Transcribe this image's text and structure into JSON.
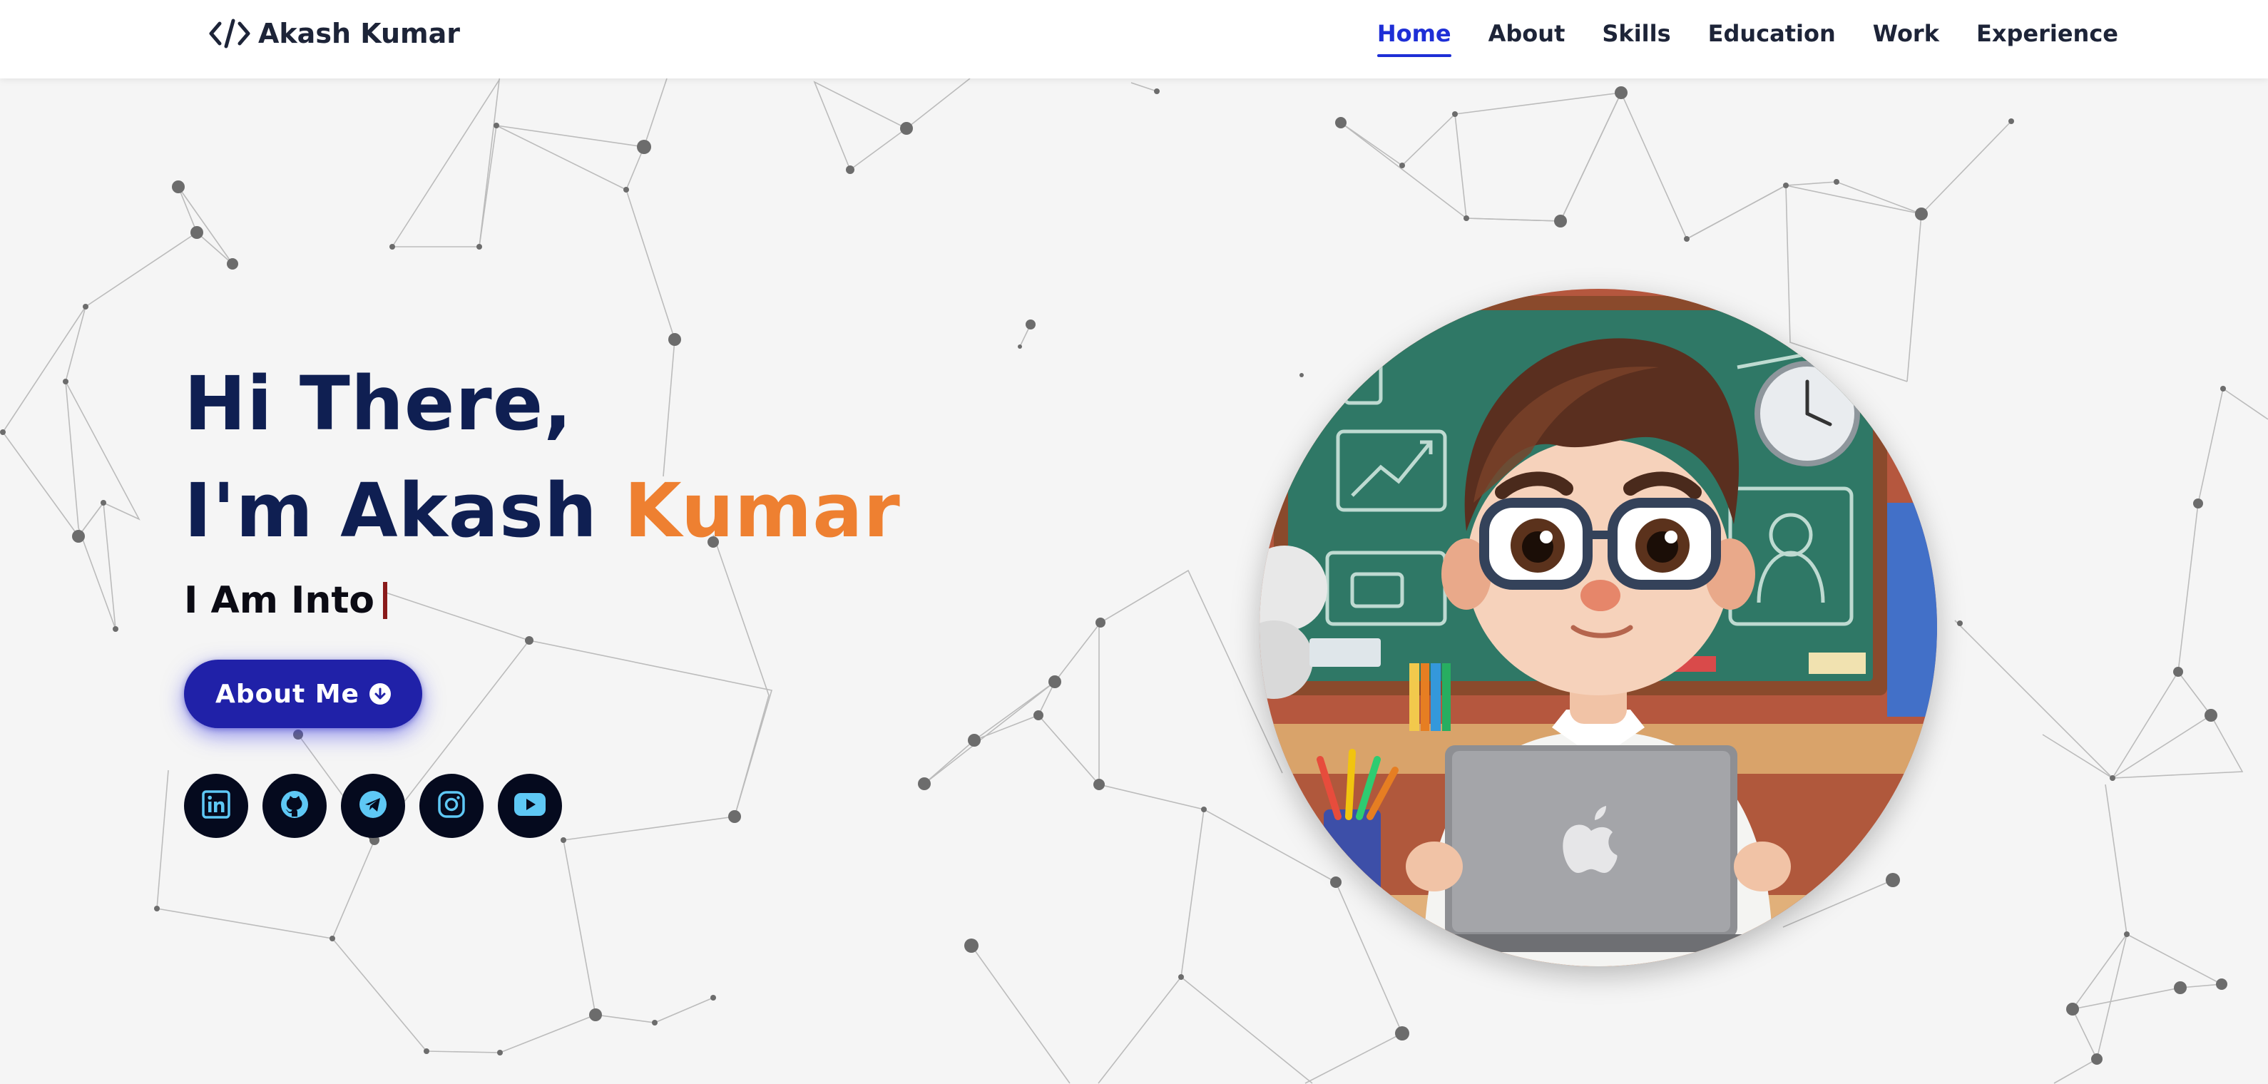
{
  "brand": {
    "name": "Akash Kumar",
    "icon": "code-icon"
  },
  "nav": {
    "items": [
      {
        "label": "Home",
        "active": true
      },
      {
        "label": "About",
        "active": false
      },
      {
        "label": "Skills",
        "active": false
      },
      {
        "label": "Education",
        "active": false
      },
      {
        "label": "Work",
        "active": false
      },
      {
        "label": "Experience",
        "active": false
      }
    ],
    "active_color": "#1e2fd6"
  },
  "hero": {
    "greeting": "Hi There,",
    "intro_prefix": "I'm Akash ",
    "intro_accent": "Kumar",
    "typing_prefix": "I Am Into",
    "accent_color": "#ee8031",
    "button_label": "About Me",
    "button_icon": "arrow-down-circle-icon"
  },
  "socials": [
    {
      "name": "linkedin",
      "icon": "linkedin-icon"
    },
    {
      "name": "github",
      "icon": "github-icon"
    },
    {
      "name": "telegram",
      "icon": "telegram-icon"
    },
    {
      "name": "instagram",
      "icon": "instagram-icon"
    },
    {
      "name": "youtube",
      "icon": "youtube-icon"
    }
  ],
  "colors": {
    "background": "#f5f5f5",
    "heading": "#0f1f52",
    "button": "#2021a8",
    "social_bg": "#050a1e",
    "social_icon": "#5ec8f5"
  }
}
